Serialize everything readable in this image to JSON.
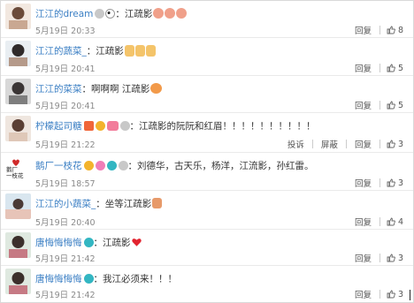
{
  "comments": [
    {
      "user": "江江的dream",
      "badges": [
        "silver"
      ],
      "pre_emojis": [
        "panda"
      ],
      "text": "：江疏影",
      "post_emojis": [
        "pig",
        "pig",
        "pig"
      ],
      "time": "5月19日 20:33",
      "actions": [
        "回复"
      ],
      "likes": "8"
    },
    {
      "user": "江江的蔬菜_",
      "badges": [],
      "pre_emojis": [],
      "text": "：江疏影",
      "post_emojis": [
        "victory",
        "victory",
        "victory"
      ],
      "time": "5月19日 20:41",
      "actions": [
        "回复"
      ],
      "likes": "5"
    },
    {
      "user": "江江的菜菜",
      "badges": [],
      "pre_emojis": [],
      "text": "：啊啊啊 江疏影",
      "post_emojis": [
        "clap"
      ],
      "time": "5月19日 20:41",
      "actions": [
        "回复"
      ],
      "likes": "5"
    },
    {
      "user": "柠檬起司糖",
      "badges": [
        "star",
        "crown",
        "vip",
        "silver"
      ],
      "pre_emojis": [],
      "text": "：江疏影的阮阮和红眉！！！！！！！！！！",
      "post_emojis": [],
      "time": "5月19日 21:22",
      "actions": [
        "投诉",
        "屏蔽",
        "回复"
      ],
      "likes": "3"
    },
    {
      "user": "鹅厂一枝花",
      "badges": [
        "v-gold",
        "w-pink",
        "teal",
        "silver"
      ],
      "pre_emojis": [],
      "text": "：刘德华，古天乐，杨洋，江流影，孙红雷。",
      "post_emojis": [],
      "time": "5月19日 18:57",
      "actions": [
        "回复"
      ],
      "likes": "3"
    },
    {
      "user": "江江的小蔬菜_",
      "badges": [],
      "pre_emojis": [],
      "text": "：坐等江疏影",
      "post_emojis": [
        "bow"
      ],
      "time": "5月19日 20:40",
      "actions": [
        "回复"
      ],
      "likes": "4"
    },
    {
      "user": "唐悔悔悔悔",
      "badges": [
        "teal"
      ],
      "pre_emojis": [],
      "text": "：江疏影",
      "post_emojis": [
        "heart"
      ],
      "time": "5月19日 21:42",
      "actions": [
        "回复"
      ],
      "likes": "3"
    },
    {
      "user": "唐悔悔悔悔",
      "badges": [
        "teal"
      ],
      "pre_emojis": [],
      "text": "：我江必须来！！！",
      "post_emojis": [],
      "time": "5月19日 21:42",
      "actions": [
        "回复"
      ],
      "likes": "3"
    }
  ],
  "colors": {
    "link": "#3b7fc4",
    "time": "#8a8a8a",
    "action": "#555555"
  },
  "avatar_texts": {
    "3": "",
    "4": "鹅厂\n一枝花"
  }
}
